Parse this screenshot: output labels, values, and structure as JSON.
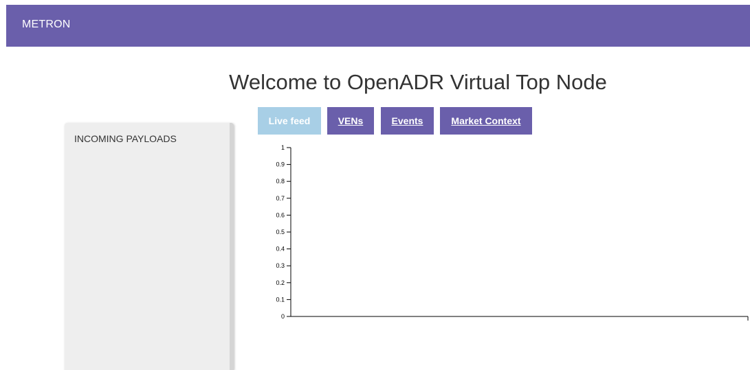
{
  "navbar": {
    "brand": "METRON",
    "color": "#6a5fab"
  },
  "page": {
    "title": "Welcome to OpenADR Virtual Top Node"
  },
  "tabs": [
    {
      "label": "Live feed",
      "active": true
    },
    {
      "label": "VENs",
      "active": false
    },
    {
      "label": "Events",
      "active": false
    },
    {
      "label": "Market Context",
      "active": false
    }
  ],
  "panel": {
    "title": "INCOMING PAYLOADS"
  },
  "chart_data": {
    "type": "line",
    "series": [],
    "ylim": [
      0,
      1
    ],
    "yticks": [
      "0",
      "0.1",
      "0.2",
      "0.3",
      "0.4",
      "0.5",
      "0.6",
      "0.7",
      "0.8",
      "0.9",
      "1"
    ],
    "grid": false
  }
}
